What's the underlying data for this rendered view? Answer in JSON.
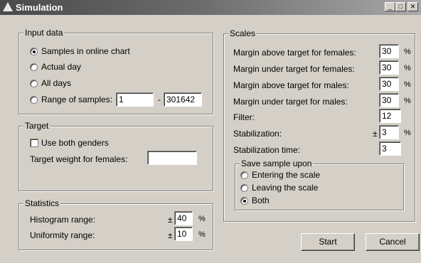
{
  "window": {
    "title": "Simulation"
  },
  "input_data": {
    "legend": "Input data",
    "options": [
      {
        "label": "Samples in online chart",
        "selected": true
      },
      {
        "label": "Actual day",
        "selected": false
      },
      {
        "label": "All days",
        "selected": false
      },
      {
        "label": "Range of samples:",
        "selected": false
      }
    ],
    "range_from": "1",
    "range_sep": "-",
    "range_to": "301642"
  },
  "target": {
    "legend": "Target",
    "use_both_genders_label": "Use both genders",
    "use_both_genders_checked": false,
    "weight_label": "Target weight for females:",
    "weight_value": ""
  },
  "statistics": {
    "legend": "Statistics",
    "histogram_label": "Histogram range:",
    "histogram_prefix": "±",
    "histogram_value": "40",
    "histogram_unit": "%",
    "uniformity_label": "Uniformity range:",
    "uniformity_prefix": "±",
    "uniformity_value": "10",
    "uniformity_unit": "%"
  },
  "scales": {
    "legend": "Scales",
    "rows": [
      {
        "label": "Margin above target for females:",
        "value": "30",
        "unit": "%"
      },
      {
        "label": "Margin under target for females:",
        "value": "30",
        "unit": "%"
      },
      {
        "label": "Margin above target for males:",
        "value": "30",
        "unit": "%"
      },
      {
        "label": "Margin under target for males:",
        "value": "30",
        "unit": "%"
      },
      {
        "label": "Filter:",
        "value": "12",
        "unit": ""
      },
      {
        "label": "Stabilization:",
        "value": "3",
        "unit": "%",
        "prefix": "±"
      },
      {
        "label": "Stabilization time:",
        "value": "3",
        "unit": ""
      }
    ],
    "save_sample": {
      "legend": "Save sample upon",
      "options": [
        {
          "label": "Entering the scale",
          "selected": false
        },
        {
          "label": "Leaving the scale",
          "selected": false
        },
        {
          "label": "Both",
          "selected": true
        }
      ]
    }
  },
  "buttons": {
    "start": "Start",
    "cancel": "Cancel"
  }
}
